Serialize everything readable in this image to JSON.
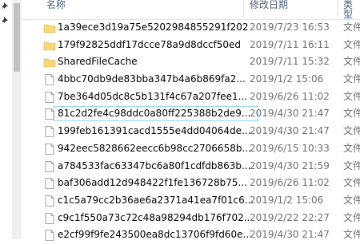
{
  "columns": {
    "name": "名称",
    "date": "修改日期",
    "type": "类型"
  },
  "rows": [
    {
      "icon": "folder-icon",
      "name": "1a39ece3d19a75e5202984855291f202",
      "date": "2019/7/23 16:53",
      "type": "文件"
    },
    {
      "icon": "folder-icon",
      "name": "179f92825ddf17dcce78a9d8dccf50ed",
      "date": "2019/7/11 16:11",
      "type": "文件"
    },
    {
      "icon": "folder-icon",
      "name": "SharedFileCache",
      "date": "2019/7/11 15:32",
      "type": "文件"
    },
    {
      "icon": "file-icon",
      "name": "4bbc70db9de83bba347b4a6b869fa2...",
      "date": "2019/1/2 15:06",
      "type": "文件"
    },
    {
      "icon": "file-icon",
      "name": "7be364d05dc8c5b131f4c67a207fee1...",
      "date": "2019/6/26 11:02",
      "type": "文件"
    },
    {
      "icon": "file-icon",
      "name": "81c2d2fe4c98ddc0a80ff225388b2de9...",
      "date": "2019/4/30 21:47",
      "type": "文件",
      "selected": true
    },
    {
      "icon": "file-icon",
      "name": "199feb161391cacd1555e4dd04064de...",
      "date": "2019/4/30 21:47",
      "type": "文件"
    },
    {
      "icon": "file-icon",
      "name": "942eec5828662eecc6b98cc2706658b...",
      "date": "2019/6/15 10:33",
      "type": "文件"
    },
    {
      "icon": "file-icon",
      "name": "a784533fac63347bc6a80f1cdfdb863b...",
      "date": "2019/4/30 21:59",
      "type": "文件"
    },
    {
      "icon": "file-icon",
      "name": "baf306add12d948422f1fe136728b75...",
      "date": "2019/6/26 11:02",
      "type": "文件"
    },
    {
      "icon": "file-icon",
      "name": "c1c5a79cc2b36ae6a2371a41ea7f01c6...",
      "date": "2019/1/2 15:06",
      "type": "文件"
    },
    {
      "icon": "file-icon",
      "name": "c9c1f550a73c72c48a98294db176f702...",
      "date": "2019/2/22 22:27",
      "type": "文件"
    },
    {
      "icon": "file-icon",
      "name": "e2cf99f9fe243500ea8dc13706f9fd60e...",
      "date": "2019/4/30 21:47",
      "type": "文件"
    }
  ],
  "colors": {
    "folder": "#f8d775",
    "selected_border": "#99d1ff",
    "header_text": "#4c607a"
  }
}
